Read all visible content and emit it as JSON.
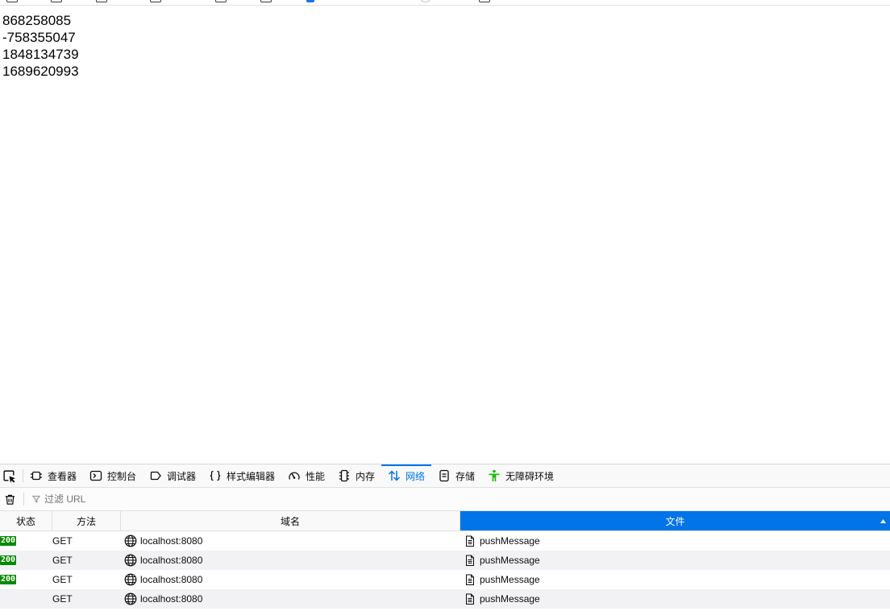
{
  "browser": {
    "bookmark_icons": [
      "bookmark-icon",
      "bookmark-icon",
      "bookmark-icon",
      "bookmark-icon",
      "bookmark-icon",
      "bookmark-icon",
      "bookmark-favicon-icon",
      "bookmark-icon",
      "bookmark-icon"
    ]
  },
  "page": {
    "lines": [
      "868258085",
      "-758355047",
      "1848134739",
      "1689620993"
    ]
  },
  "devtools": {
    "toolbar": {
      "picker_icon": "element-picker-icon",
      "tabs": [
        {
          "label": "查看器",
          "icon": "inspector-icon",
          "selected": false
        },
        {
          "label": "控制台",
          "icon": "console-icon",
          "selected": false
        },
        {
          "label": "调试器",
          "icon": "debugger-icon",
          "selected": false
        },
        {
          "label": "样式编辑器",
          "icon": "style-editor-icon",
          "selected": false
        },
        {
          "label": "性能",
          "icon": "performance-icon",
          "selected": false
        },
        {
          "label": "内存",
          "icon": "memory-icon",
          "selected": false
        },
        {
          "label": "网络",
          "icon": "network-icon",
          "selected": true
        },
        {
          "label": "存储",
          "icon": "storage-icon",
          "selected": false
        },
        {
          "label": "无障碍环境",
          "icon": "accessibility-icon",
          "selected": false
        }
      ]
    },
    "filter": {
      "clear_icon": "trash-icon",
      "filter_icon": "filter-icon",
      "placeholder": "过滤 URL"
    },
    "table": {
      "columns": [
        {
          "label": "状态",
          "sorted": false
        },
        {
          "label": "方法",
          "sorted": false
        },
        {
          "label": "域名",
          "sorted": false
        },
        {
          "label": "文件",
          "sorted": true,
          "sort_icon": "sort-arrow-up-icon"
        }
      ],
      "rows": [
        {
          "status": "200",
          "method": "GET",
          "domain_icon": "globe-icon",
          "domain": "localhost:8080",
          "file_icon": "document-icon",
          "file": "pushMessage"
        },
        {
          "status": "200",
          "method": "GET",
          "domain_icon": "globe-icon",
          "domain": "localhost:8080",
          "file_icon": "document-icon",
          "file": "pushMessage"
        },
        {
          "status": "200",
          "method": "GET",
          "domain_icon": "globe-icon",
          "domain": "localhost:8080",
          "file_icon": "document-icon",
          "file": "pushMessage"
        },
        {
          "status": null,
          "method": "GET",
          "domain_icon": "globe-icon",
          "domain": "localhost:8080",
          "file_icon": "document-icon",
          "file": "pushMessage"
        }
      ]
    }
  },
  "colors": {
    "accent": "#0074e8",
    "status_ok": "#058b00",
    "accessibility_icon": "#12bc00",
    "row_stripe": "#f2f2f4"
  }
}
